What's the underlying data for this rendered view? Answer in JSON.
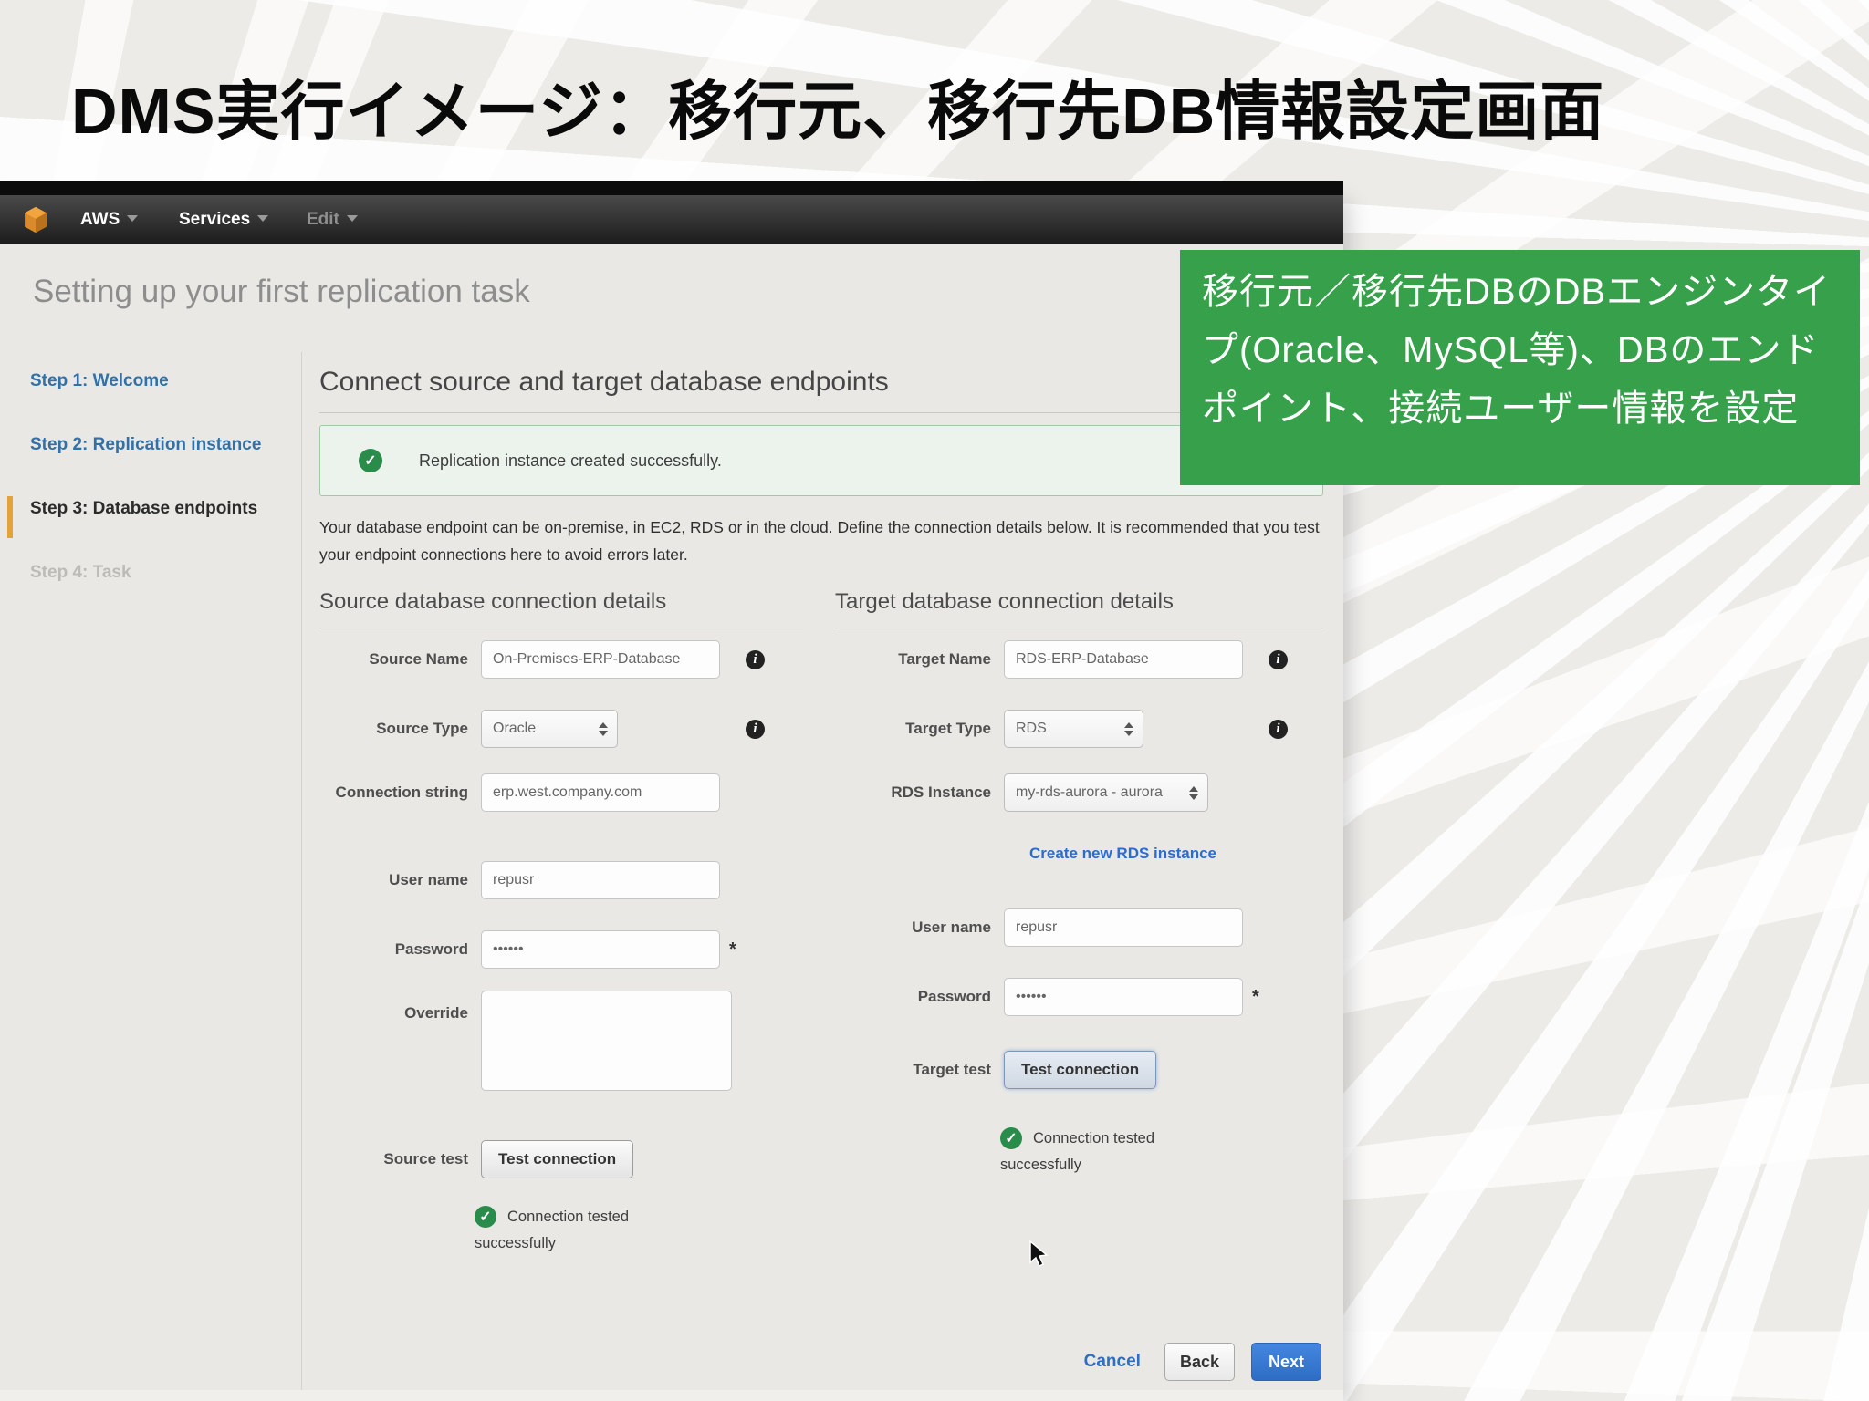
{
  "slide": {
    "title": "DMS実行イメージ：移行元、移行先DB情報設定画面"
  },
  "annotation": {
    "text": "移行元／移行先DBのDBエンジンタイプ(Oracle、MySQL等)、DBのエンドポイント、接続ユーザー情報を設定",
    "bg_color": "#36a04b"
  },
  "nav": {
    "aws": "AWS",
    "services": "Services",
    "edit": "Edit"
  },
  "console": {
    "page_title": "Setting up your first replication task",
    "steps": [
      {
        "label": "Step 1: Welcome"
      },
      {
        "label": "Step 2: Replication instance"
      },
      {
        "label": "Step 3: Database endpoints"
      },
      {
        "label": "Step 4: Task"
      }
    ],
    "heading": "Connect source and target database endpoints",
    "alert": "Replication instance created successfully.",
    "description": "Your database endpoint can be on-premise, in EC2, RDS or in the cloud. Define the connection details below. It is recommended that you test your endpoint connections here to avoid errors later.",
    "source": {
      "heading": "Source database connection details",
      "name_label": "Source Name",
      "name_value": "On-Premises-ERP-Database",
      "type_label": "Source Type",
      "type_value": "Oracle",
      "conn_label": "Connection string",
      "conn_value": "erp.west.company.com",
      "user_label": "User name",
      "user_value": "repusr",
      "pass_label": "Password",
      "pass_value": "••••••",
      "pass_required": "*",
      "override_label": "Override",
      "test_label": "Source test",
      "test_button": "Test connection",
      "tested_line1": "Connection tested",
      "tested_line2": "successfully"
    },
    "target": {
      "heading": "Target database connection details",
      "name_label": "Target Name",
      "name_value": "RDS-ERP-Database",
      "type_label": "Target Type",
      "type_value": "RDS",
      "rds_label": "RDS Instance",
      "rds_value": "my-rds-aurora - aurora",
      "create_link": "Create new RDS instance",
      "user_label": "User name",
      "user_value": "repusr",
      "pass_label": "Password",
      "pass_value": "••••••",
      "pass_required": "*",
      "test_label": "Target test",
      "test_button": "Test connection",
      "tested_line1": "Connection tested",
      "tested_line2": "successfully"
    },
    "footer": {
      "cancel": "Cancel",
      "back": "Back",
      "next": "Next"
    }
  }
}
